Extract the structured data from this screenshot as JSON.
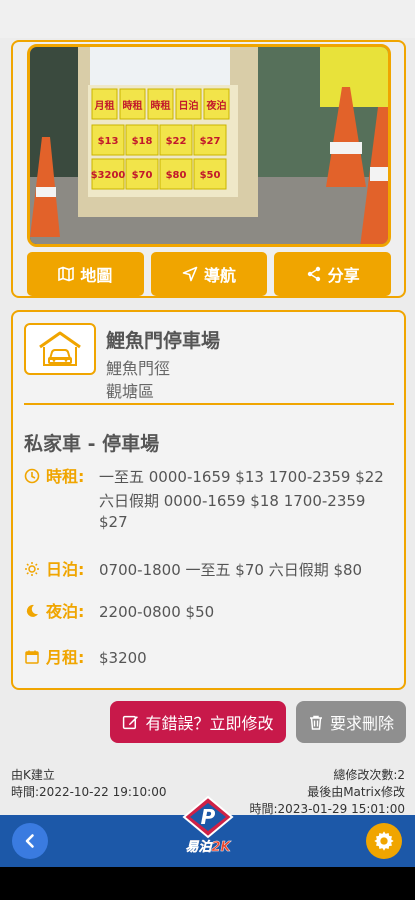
{
  "colors": {
    "accent": "#f0a500",
    "danger": "#c8194a",
    "neutral": "#8f8f8f",
    "bar": "#1c58a8"
  },
  "photo": {
    "booth_signs": [
      "月租",
      "時租",
      "時租",
      "日泊",
      "夜泊"
    ],
    "booth_prices": [
      "$13",
      "$18",
      "$22",
      "$27",
      "$3200",
      "$70",
      "$80",
      "$50"
    ]
  },
  "actions": {
    "map": {
      "label": "地圖",
      "icon": "map-icon"
    },
    "navigate": {
      "label": "導航",
      "icon": "navigation-arrow-icon"
    },
    "share": {
      "label": "分享",
      "icon": "share-icon"
    }
  },
  "place": {
    "name": "鯉魚門停車場",
    "street": "鯉魚門徑",
    "district": "觀塘區",
    "icon": "carpark-icon"
  },
  "section_title": "私家車 - 停車場",
  "rates": {
    "hourly": {
      "label": "時租:",
      "icon": "clock-icon",
      "line1": "一至五 0000-1659 $13 1700-2359 $22",
      "line2": "六日假期  0000-1659 $18 1700-2359",
      "line3": "$27"
    },
    "day": {
      "label": "日泊:",
      "icon": "sun-icon",
      "value": "0700-1800 一至五 $70 六日假期 $80"
    },
    "night": {
      "label": "夜泊:",
      "icon": "moon-icon",
      "value": "2200-0800 $50"
    },
    "monthly": {
      "label": "月租:",
      "icon": "calendar-icon",
      "value": "$3200"
    }
  },
  "buttons": {
    "report": {
      "label": "有錯誤？立即修改",
      "icon": "edit-icon"
    },
    "delete": {
      "label": "要求刪除",
      "icon": "trash-icon"
    }
  },
  "footer": {
    "created_by": "由K建立",
    "created_time": "時間:2022-10-22 19:10:00",
    "edit_count": "總修改次數:2",
    "last_edited_by": "最後由Matrix修改",
    "edited_time": "時間:2023-01-29 15:01:00"
  },
  "bottom_bar": {
    "logo_text": "易泊2K",
    "back_icon": "chevron-left-icon",
    "settings_icon": "gear-icon"
  }
}
